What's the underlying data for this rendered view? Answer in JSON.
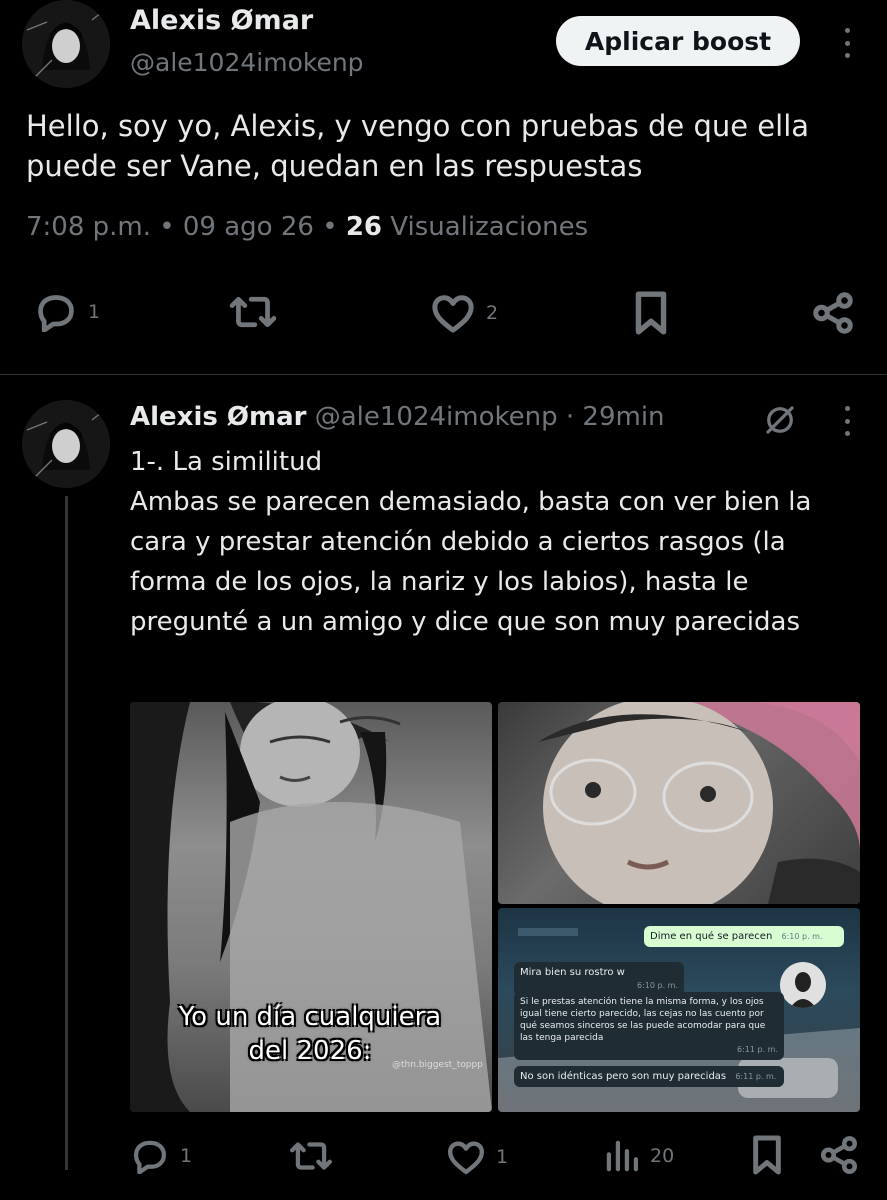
{
  "main_tweet": {
    "author_name": "Alexis Ømar",
    "author_handle": "@ale1024imokenp",
    "boost_button": "Aplicar boost",
    "text": "Hello, soy yo, Alexis, y vengo con pruebas de que ella puede ser Vane, quedan en las respuestas",
    "time": "7:08 p.m.",
    "date": "09 ago 26",
    "views_count": "26",
    "views_label": "Visualizaciones",
    "actions": {
      "replies": "1",
      "likes": "2"
    }
  },
  "reply": {
    "author_name": "Alexis Ømar",
    "author_handle": "@ale1024imokenp",
    "age": "29min",
    "title": "1-. La similitud",
    "body": "Ambas se parecen demasiado, basta con ver bien la cara y prestar atención debido a ciertos rasgos (la forma de los ojos, la nariz y los labios), hasta le pregunté a un amigo y dice que son muy parecidas",
    "media": {
      "caption": "Yo un día cualquiera del 2026:",
      "watermark": "@thn.biggest_toppp",
      "chat": {
        "out_1": "Dime en qué se parecen",
        "out_1_time": "6:10 p. m.",
        "in_1": "Mira bien su rostro w",
        "in_1_time": "6:10 p. m.",
        "in_2": "Si le prestas atención tiene la misma forma, y los ojos igual tiene cierto parecido, las cejas no las cuento por qué seamos sinceros se las puede acomodar para que las tenga parecida",
        "in_2_time": "6:11 p. m.",
        "in_3": "No son idénticas pero son muy parecidas",
        "in_3_time": "6:11 p. m."
      }
    },
    "actions": {
      "replies": "1",
      "likes": "1",
      "views": "20"
    }
  },
  "icons": [
    "avatar",
    "kebab-icon",
    "reply-icon",
    "retweet-icon",
    "like-icon",
    "bookmark-icon",
    "share-icon",
    "views-icon",
    "grok-icon"
  ]
}
